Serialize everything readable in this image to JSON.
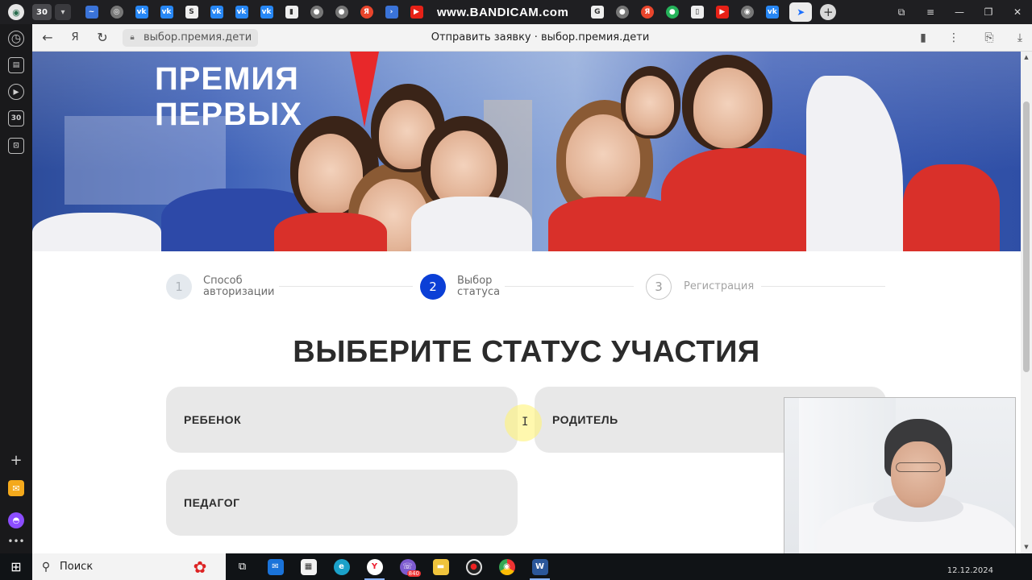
{
  "browser": {
    "tab_count": "30",
    "recorder_watermark": "www.BANDICAM.com",
    "favicons": [
      {
        "name": "vk-tab-icon",
        "label": "vk",
        "style": "vk"
      },
      {
        "name": "vk-tab-icon",
        "label": "vk",
        "style": "vk"
      },
      {
        "name": "vk-tab-icon",
        "label": "vk",
        "style": "vk"
      },
      {
        "name": "vk-tab-icon",
        "label": "vk",
        "style": "vk"
      },
      {
        "name": "vk-tab-icon",
        "label": "vk",
        "style": "vk"
      },
      {
        "name": "yandex-tab-icon",
        "label": "Я",
        "style": "ya"
      },
      {
        "name": "youtube-tab-icon",
        "label": "▶",
        "style": "yt"
      }
    ],
    "address": {
      "url": "выбор.премия.дети",
      "page_title": "Отправить заявку · выбор.премия.дети"
    }
  },
  "hero": {
    "title_line1": "ПРЕМИЯ",
    "title_line2": "ПЕРВЫХ"
  },
  "stepper": {
    "steps": [
      {
        "number": "1",
        "label_line1": "Способ",
        "label_line2": "авторизации",
        "state": "done"
      },
      {
        "number": "2",
        "label_line1": "Выбор",
        "label_line2": "статуса",
        "state": "active"
      },
      {
        "number": "3",
        "label_line1": "Регистрация",
        "label_line2": "",
        "state": "todo"
      }
    ]
  },
  "main": {
    "heading": "ВЫБЕРИТЕ СТАТУС УЧАСТИЯ",
    "options": {
      "child": "РЕБЕНОК",
      "parent": "РОДИТЕЛЬ",
      "teacher": "ПЕДАГОГ"
    }
  },
  "taskbar": {
    "search_placeholder": "Поиск",
    "viber_badge": "840",
    "date": "12.12.2024"
  },
  "colors": {
    "accent": "#0b3fd6",
    "hero_title": "#ffffff",
    "card_bg": "#e8e8e8",
    "heading": "#2b2b2b"
  }
}
